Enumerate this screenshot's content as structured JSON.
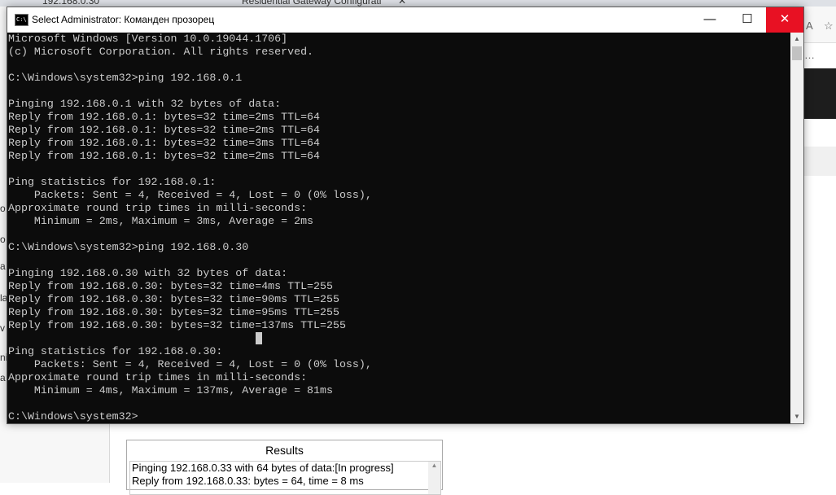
{
  "browser": {
    "tabs": [
      {
        "label": "192.168.0.30"
      },
      {
        "label": "Residential Gateway Configurati"
      }
    ],
    "left_edge_letters": [
      "o",
      "o",
      "a",
      "la",
      "v",
      "ni",
      "a"
    ]
  },
  "results_panel": {
    "title": "Results",
    "lines": [
      "Pinging 192.168.0.33 with 64 bytes of data:[In progress]",
      "Reply from 192.168.0.33: bytes = 64, time = 8 ms"
    ]
  },
  "cmd": {
    "icon_text": "C:\\",
    "title": "Select Administrator: Команден прозорец",
    "minimize_glyph": "—",
    "maximize_glyph": "☐",
    "close_glyph": "✕",
    "lines": [
      "Microsoft Windows [Version 10.0.19044.1706]",
      "(c) Microsoft Corporation. All rights reserved.",
      "",
      "C:\\Windows\\system32>ping 192.168.0.1",
      "",
      "Pinging 192.168.0.1 with 32 bytes of data:",
      "Reply from 192.168.0.1: bytes=32 time=2ms TTL=64",
      "Reply from 192.168.0.1: bytes=32 time=2ms TTL=64",
      "Reply from 192.168.0.1: bytes=32 time=3ms TTL=64",
      "Reply from 192.168.0.1: bytes=32 time=2ms TTL=64",
      "",
      "Ping statistics for 192.168.0.1:",
      "    Packets: Sent = 4, Received = 4, Lost = 0 (0% loss),",
      "Approximate round trip times in milli-seconds:",
      "    Minimum = 2ms, Maximum = 3ms, Average = 2ms",
      "",
      "C:\\Windows\\system32>ping 192.168.0.30",
      "",
      "Pinging 192.168.0.30 with 32 bytes of data:",
      "Reply from 192.168.0.30: bytes=32 time=4ms TTL=255",
      "Reply from 192.168.0.30: bytes=32 time=90ms TTL=255",
      "Reply from 192.168.0.30: bytes=32 time=95ms TTL=255",
      "Reply from 192.168.0.30: bytes=32 time=137ms TTL=255",
      "",
      "Ping statistics for 192.168.0.30:",
      "    Packets: Sent = 4, Received = 4, Lost = 0 (0% loss),",
      "Approximate round trip times in milli-seconds:",
      "    Minimum = 4ms, Maximum = 137ms, Average = 81ms",
      "",
      "C:\\Windows\\system32>"
    ]
  },
  "colors": {
    "console_bg": "#0c0c0c",
    "console_text": "#cccccc",
    "close_button": "#e81123"
  },
  "icons": [
    "cmd-app-icon",
    "minimize-icon",
    "maximize-icon",
    "close-icon",
    "scroll-up-arrow-icon",
    "scroll-down-arrow-icon"
  ]
}
